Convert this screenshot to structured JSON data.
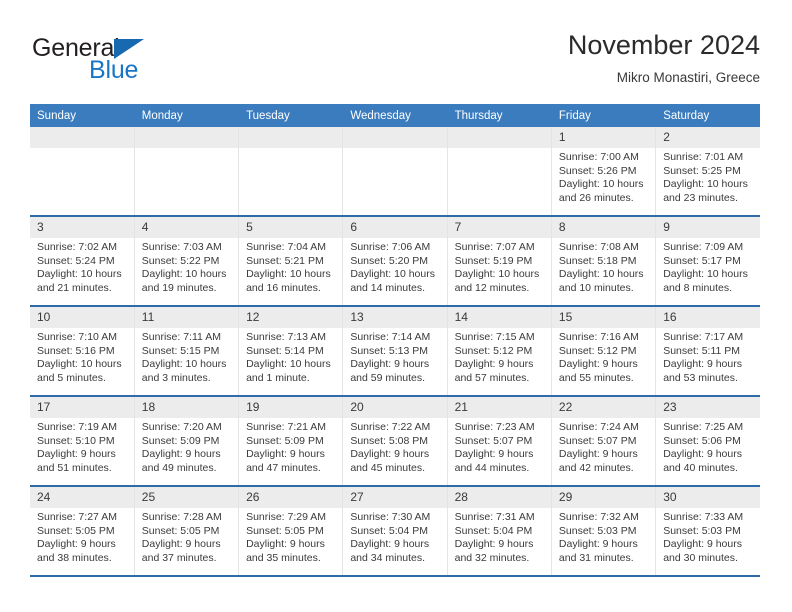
{
  "brand": {
    "name_top": "General",
    "name_bottom": "Blue",
    "accent_color": "#1976c7",
    "triangle_color": "#1769b0"
  },
  "header": {
    "title": "November 2024",
    "subtitle": "Mikro Monastiri, Greece"
  },
  "theme": {
    "header_blue": "#3a7cbe",
    "row_rule_blue": "#2e6ba8",
    "daynum_band": "#ececec",
    "text": "#3b3b3b"
  },
  "weekday_headers": [
    "Sunday",
    "Monday",
    "Tuesday",
    "Wednesday",
    "Thursday",
    "Friday",
    "Saturday"
  ],
  "weeks": [
    [
      {
        "day": "",
        "sunrise": "",
        "sunset": "",
        "daylight": "",
        "daylight2": ""
      },
      {
        "day": "",
        "sunrise": "",
        "sunset": "",
        "daylight": "",
        "daylight2": ""
      },
      {
        "day": "",
        "sunrise": "",
        "sunset": "",
        "daylight": "",
        "daylight2": ""
      },
      {
        "day": "",
        "sunrise": "",
        "sunset": "",
        "daylight": "",
        "daylight2": ""
      },
      {
        "day": "",
        "sunrise": "",
        "sunset": "",
        "daylight": "",
        "daylight2": ""
      },
      {
        "day": "1",
        "sunrise": "Sunrise: 7:00 AM",
        "sunset": "Sunset: 5:26 PM",
        "daylight": "Daylight: 10 hours",
        "daylight2": "and 26 minutes."
      },
      {
        "day": "2",
        "sunrise": "Sunrise: 7:01 AM",
        "sunset": "Sunset: 5:25 PM",
        "daylight": "Daylight: 10 hours",
        "daylight2": "and 23 minutes."
      }
    ],
    [
      {
        "day": "3",
        "sunrise": "Sunrise: 7:02 AM",
        "sunset": "Sunset: 5:24 PM",
        "daylight": "Daylight: 10 hours",
        "daylight2": "and 21 minutes."
      },
      {
        "day": "4",
        "sunrise": "Sunrise: 7:03 AM",
        "sunset": "Sunset: 5:22 PM",
        "daylight": "Daylight: 10 hours",
        "daylight2": "and 19 minutes."
      },
      {
        "day": "5",
        "sunrise": "Sunrise: 7:04 AM",
        "sunset": "Sunset: 5:21 PM",
        "daylight": "Daylight: 10 hours",
        "daylight2": "and 16 minutes."
      },
      {
        "day": "6",
        "sunrise": "Sunrise: 7:06 AM",
        "sunset": "Sunset: 5:20 PM",
        "daylight": "Daylight: 10 hours",
        "daylight2": "and 14 minutes."
      },
      {
        "day": "7",
        "sunrise": "Sunrise: 7:07 AM",
        "sunset": "Sunset: 5:19 PM",
        "daylight": "Daylight: 10 hours",
        "daylight2": "and 12 minutes."
      },
      {
        "day": "8",
        "sunrise": "Sunrise: 7:08 AM",
        "sunset": "Sunset: 5:18 PM",
        "daylight": "Daylight: 10 hours",
        "daylight2": "and 10 minutes."
      },
      {
        "day": "9",
        "sunrise": "Sunrise: 7:09 AM",
        "sunset": "Sunset: 5:17 PM",
        "daylight": "Daylight: 10 hours",
        "daylight2": "and 8 minutes."
      }
    ],
    [
      {
        "day": "10",
        "sunrise": "Sunrise: 7:10 AM",
        "sunset": "Sunset: 5:16 PM",
        "daylight": "Daylight: 10 hours",
        "daylight2": "and 5 minutes."
      },
      {
        "day": "11",
        "sunrise": "Sunrise: 7:11 AM",
        "sunset": "Sunset: 5:15 PM",
        "daylight": "Daylight: 10 hours",
        "daylight2": "and 3 minutes."
      },
      {
        "day": "12",
        "sunrise": "Sunrise: 7:13 AM",
        "sunset": "Sunset: 5:14 PM",
        "daylight": "Daylight: 10 hours",
        "daylight2": "and 1 minute."
      },
      {
        "day": "13",
        "sunrise": "Sunrise: 7:14 AM",
        "sunset": "Sunset: 5:13 PM",
        "daylight": "Daylight: 9 hours",
        "daylight2": "and 59 minutes."
      },
      {
        "day": "14",
        "sunrise": "Sunrise: 7:15 AM",
        "sunset": "Sunset: 5:12 PM",
        "daylight": "Daylight: 9 hours",
        "daylight2": "and 57 minutes."
      },
      {
        "day": "15",
        "sunrise": "Sunrise: 7:16 AM",
        "sunset": "Sunset: 5:12 PM",
        "daylight": "Daylight: 9 hours",
        "daylight2": "and 55 minutes."
      },
      {
        "day": "16",
        "sunrise": "Sunrise: 7:17 AM",
        "sunset": "Sunset: 5:11 PM",
        "daylight": "Daylight: 9 hours",
        "daylight2": "and 53 minutes."
      }
    ],
    [
      {
        "day": "17",
        "sunrise": "Sunrise: 7:19 AM",
        "sunset": "Sunset: 5:10 PM",
        "daylight": "Daylight: 9 hours",
        "daylight2": "and 51 minutes."
      },
      {
        "day": "18",
        "sunrise": "Sunrise: 7:20 AM",
        "sunset": "Sunset: 5:09 PM",
        "daylight": "Daylight: 9 hours",
        "daylight2": "and 49 minutes."
      },
      {
        "day": "19",
        "sunrise": "Sunrise: 7:21 AM",
        "sunset": "Sunset: 5:09 PM",
        "daylight": "Daylight: 9 hours",
        "daylight2": "and 47 minutes."
      },
      {
        "day": "20",
        "sunrise": "Sunrise: 7:22 AM",
        "sunset": "Sunset: 5:08 PM",
        "daylight": "Daylight: 9 hours",
        "daylight2": "and 45 minutes."
      },
      {
        "day": "21",
        "sunrise": "Sunrise: 7:23 AM",
        "sunset": "Sunset: 5:07 PM",
        "daylight": "Daylight: 9 hours",
        "daylight2": "and 44 minutes."
      },
      {
        "day": "22",
        "sunrise": "Sunrise: 7:24 AM",
        "sunset": "Sunset: 5:07 PM",
        "daylight": "Daylight: 9 hours",
        "daylight2": "and 42 minutes."
      },
      {
        "day": "23",
        "sunrise": "Sunrise: 7:25 AM",
        "sunset": "Sunset: 5:06 PM",
        "daylight": "Daylight: 9 hours",
        "daylight2": "and 40 minutes."
      }
    ],
    [
      {
        "day": "24",
        "sunrise": "Sunrise: 7:27 AM",
        "sunset": "Sunset: 5:05 PM",
        "daylight": "Daylight: 9 hours",
        "daylight2": "and 38 minutes."
      },
      {
        "day": "25",
        "sunrise": "Sunrise: 7:28 AM",
        "sunset": "Sunset: 5:05 PM",
        "daylight": "Daylight: 9 hours",
        "daylight2": "and 37 minutes."
      },
      {
        "day": "26",
        "sunrise": "Sunrise: 7:29 AM",
        "sunset": "Sunset: 5:05 PM",
        "daylight": "Daylight: 9 hours",
        "daylight2": "and 35 minutes."
      },
      {
        "day": "27",
        "sunrise": "Sunrise: 7:30 AM",
        "sunset": "Sunset: 5:04 PM",
        "daylight": "Daylight: 9 hours",
        "daylight2": "and 34 minutes."
      },
      {
        "day": "28",
        "sunrise": "Sunrise: 7:31 AM",
        "sunset": "Sunset: 5:04 PM",
        "daylight": "Daylight: 9 hours",
        "daylight2": "and 32 minutes."
      },
      {
        "day": "29",
        "sunrise": "Sunrise: 7:32 AM",
        "sunset": "Sunset: 5:03 PM",
        "daylight": "Daylight: 9 hours",
        "daylight2": "and 31 minutes."
      },
      {
        "day": "30",
        "sunrise": "Sunrise: 7:33 AM",
        "sunset": "Sunset: 5:03 PM",
        "daylight": "Daylight: 9 hours",
        "daylight2": "and 30 minutes."
      }
    ]
  ]
}
